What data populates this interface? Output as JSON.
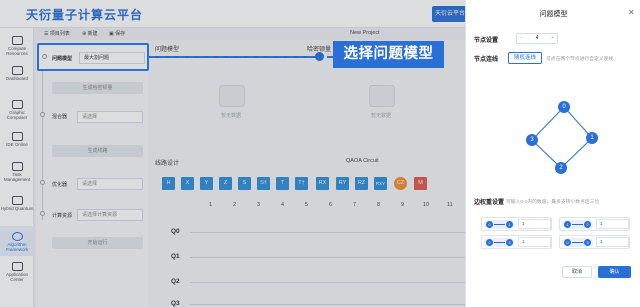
{
  "app": {
    "brand": "天衍量子计算云平台",
    "top_action": "天衍云平台入口"
  },
  "sidenav": {
    "items": [
      {
        "label": "Compute Resources",
        "icon": "monitor-icon"
      },
      {
        "label": "Dashboard",
        "icon": "dashboard-icon"
      },
      {
        "label": "Graphic Composer",
        "icon": "composer-icon"
      },
      {
        "label": "IDE Online",
        "icon": "ide-icon"
      },
      {
        "label": "Task Management",
        "icon": "task-icon"
      },
      {
        "label": "Hybrid Quantum",
        "icon": "hybrid-icon"
      },
      {
        "label": "Algorithm Framework",
        "icon": "algorithm-icon",
        "active": true
      },
      {
        "label": "Application Center",
        "icon": "app-center-icon"
      }
    ]
  },
  "toolbar": {
    "project_list": "项目列表",
    "new": "新建",
    "save": "保存",
    "project_title": "New Project"
  },
  "config": {
    "problem_model_label": "问题模型",
    "problem_model_value": "最大割问题",
    "generate_hamiltonian": "生成哈密顿量",
    "mixer_label": "混合器",
    "mixer_value": "请选择",
    "generate_circuit": "生成线路",
    "optimizer_label": "优化器",
    "optimizer_value": "请选择",
    "compute_label": "计算资源",
    "compute_value": "请选择计算资源",
    "start_compute": "开始运行"
  },
  "steps": {
    "step1": "问题模型",
    "step2": "哈密顿量",
    "empty_1": "暂无数据",
    "empty_2": "暂无数据"
  },
  "callout": "选择问题模型",
  "circuit": {
    "title": "线路设计",
    "subtitle": "QAOA Circuit",
    "gates": [
      "H",
      "X",
      "Y",
      "Z",
      "S",
      "S†",
      "T",
      "T†",
      "RX",
      "RY",
      "RZ",
      "RXY",
      "CZ",
      "M"
    ],
    "columns": [
      "1",
      "2",
      "3",
      "4",
      "5",
      "6",
      "7",
      "8",
      "9",
      "10",
      "11"
    ],
    "qubits": [
      "Q0",
      "Q1",
      "Q2",
      "Q3"
    ]
  },
  "panel": {
    "title": "问题模型",
    "node_count_label": "节点设置",
    "node_count_value": "4",
    "node_link_label": "节点连线",
    "random_link": "随机连线",
    "link_hint": "可点击两个节点进行自定义连线",
    "graph_nodes": [
      "0",
      "1",
      "2",
      "3"
    ],
    "weight_label": "边权重设置",
    "weight_hint": "可输入0-1内的数值，最多支持小数点后三位",
    "edges": [
      {
        "a": "0",
        "b": "1",
        "w": "1"
      },
      {
        "a": "1",
        "b": "2",
        "w": "1"
      },
      {
        "a": "2",
        "b": "3",
        "w": "1"
      },
      {
        "a": "0",
        "b": "3",
        "w": "1"
      }
    ],
    "cancel": "取消",
    "confirm": "确认"
  }
}
